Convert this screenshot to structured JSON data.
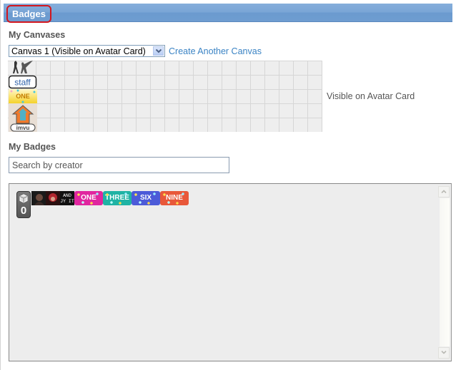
{
  "header": {
    "title": "Badges"
  },
  "canvases": {
    "section_label": "My Canvases",
    "selected_canvas": "Canvas 1 (Visible on Avatar Card)",
    "create_link": "Create Another Canvas",
    "visibility_label": "Visible on Avatar Card",
    "placed_badges": [
      {
        "name": "silhouettes-badge-icon"
      },
      {
        "name": "staff-badge",
        "text": "staff"
      },
      {
        "name": "one-badge",
        "text": "ONE"
      },
      {
        "name": "imvu-badge",
        "text": "imvu"
      }
    ]
  },
  "badges": {
    "section_label": "My Badges",
    "search_placeholder": "Search by creator",
    "counter_value": "0",
    "items": [
      {
        "name": "photo-badge-1"
      },
      {
        "name": "photo-badge-2"
      },
      {
        "name": "text-badge",
        "text": "AND\nJY IT"
      },
      {
        "name": "one-badge",
        "text": "ONE",
        "color": "#e0269f"
      },
      {
        "name": "three-badge",
        "text": "THREE",
        "color": "#1fb3a4"
      },
      {
        "name": "six-badge",
        "text": "SIX",
        "color": "#4c5bd8"
      },
      {
        "name": "nine-badge",
        "text": "NINE",
        "color": "#e8583a"
      }
    ]
  },
  "colors": {
    "header_bg": "#7aa5d6",
    "highlight_border": "#d2161e",
    "link": "#3a83c4"
  }
}
